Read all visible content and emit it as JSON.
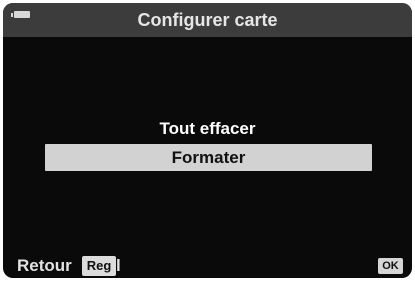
{
  "header": {
    "title": "Configurer carte",
    "battery_icon": "battery-icon"
  },
  "menu": {
    "items": [
      {
        "label": "Tout effacer",
        "selected": false
      },
      {
        "label": "Formater",
        "selected": true
      }
    ]
  },
  "footer": {
    "back_label": "Retour",
    "menu_key_label": "Reg",
    "menu_key_suffix": "l",
    "ok_label": "OK"
  },
  "colors": {
    "background": "#0a0a0a",
    "titlebar": "#3c3c3c",
    "highlight": "#d2d2d2"
  }
}
